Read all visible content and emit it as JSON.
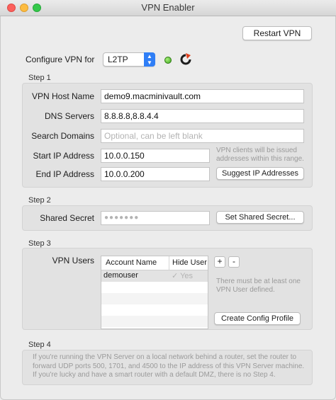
{
  "window": {
    "title": "VPN Enabler"
  },
  "toolbar": {
    "restart_label": "Restart VPN"
  },
  "configure": {
    "label": "Configure VPN for",
    "protocol": "L2TP"
  },
  "step1": {
    "title": "Step 1",
    "host_label": "VPN Host Name",
    "host_value": "demo9.macminivault.com",
    "dns_label": "DNS Servers",
    "dns_value": "8.8.8.8,8.8.4.4",
    "search_label": "Search Domains",
    "search_placeholder": "Optional, can be left blank",
    "start_label": "Start IP Address",
    "start_value": "10.0.0.150",
    "end_label": "End IP Address",
    "end_value": "10.0.0.200",
    "hint_line1": "VPN clients will be issued",
    "hint_line2": "addresses within this range.",
    "suggest_label": "Suggest IP Addresses"
  },
  "step2": {
    "title": "Step 2",
    "secret_label": "Shared Secret",
    "secret_value": "●●●●●●●",
    "set_secret_label": "Set Shared Secret..."
  },
  "step3": {
    "title": "Step 3",
    "users_label": "VPN Users",
    "columns": [
      "Account Name",
      "Hide User"
    ],
    "rows": [
      {
        "account": "demouser",
        "hide": "Yes",
        "hide_checked": true
      }
    ],
    "add_label": "+",
    "remove_label": "-",
    "hint_line1": "There must be at least one",
    "hint_line2": "VPN User defined.",
    "config_label": "Create Config Profile"
  },
  "step4": {
    "title": "Step 4",
    "line1": "If you're running the VPN Server on a local network behind a router, set the router to",
    "line2": "forward UDP ports 500, 1701, and 4500 to the IP address of this VPN Server machine.",
    "line3": "If you're lucky and have a smart router with a default DMZ, there is no Step 4."
  },
  "colors": {
    "accent": "#2f7ef6",
    "status_green": "#3da51e"
  }
}
